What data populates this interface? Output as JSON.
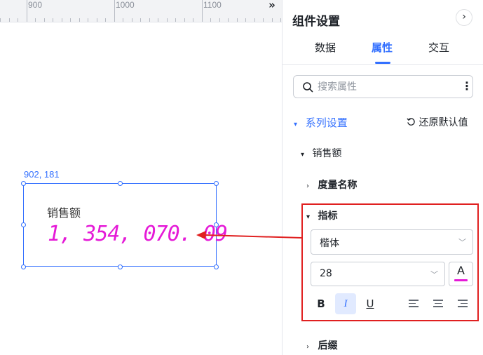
{
  "canvas": {
    "ruler": {
      "labels": [
        "900",
        "1000",
        "1100"
      ],
      "collapse_icon": "double-chevron-right-icon"
    },
    "selection_coords": "902, 181",
    "metric": {
      "label": "销售额",
      "value": "1, 354, 070. 09"
    },
    "colors": {
      "selection": "#3370ff",
      "value_text": "#e51ad7",
      "annotation": "#e02020"
    }
  },
  "panel": {
    "title": "组件设置",
    "collapse_icon": "chevron-right-icon",
    "tabs": [
      {
        "label": "数据",
        "active": false
      },
      {
        "label": "属性",
        "active": true
      },
      {
        "label": "交互",
        "active": false
      }
    ],
    "search": {
      "placeholder": "搜索属性",
      "value": ""
    },
    "series_settings": "系列设置",
    "reset_default": "还原默认值",
    "sales_section": "销售额",
    "measure_name": "度量名称",
    "indicator": {
      "label": "指标",
      "font_family": "楷体",
      "font_size": "28",
      "font_color": "#e51ad7",
      "color_button_label": "A",
      "format": {
        "bold": {
          "label": "B",
          "active": false
        },
        "italic": {
          "label": "I",
          "active": true
        },
        "underline": {
          "label": "U",
          "active": false
        }
      }
    },
    "suffix": "后缀"
  }
}
